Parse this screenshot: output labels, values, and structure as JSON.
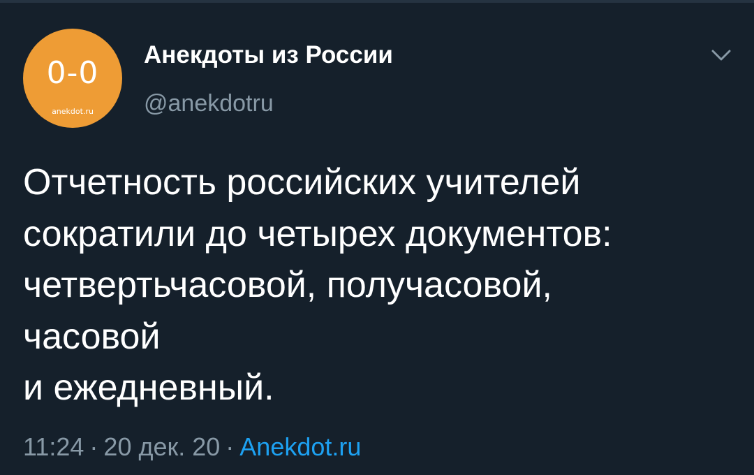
{
  "tweet": {
    "author": {
      "display_name": "Анекдоты из России",
      "handle": "@anekdotru",
      "avatar_mark": "0-0",
      "avatar_site": "anekdot.ru",
      "avatar_color": "#ee9c35"
    },
    "text_lines": [
      "Отчетность российских учителей",
      "сократили до четырех документов:",
      "четвертьчасовой, получасовой,",
      "часовой",
      "и ежедневный."
    ],
    "meta": {
      "time": "11:24",
      "separator": "·",
      "date": "20 дек. 20",
      "source": "Anekdot.ru"
    },
    "menu_icon": "chevron-down-icon"
  },
  "colors": {
    "background": "#15202b",
    "divider": "#253341",
    "text_primary": "#ffffff",
    "text_secondary": "#8899a6",
    "link": "#1da1f2"
  }
}
